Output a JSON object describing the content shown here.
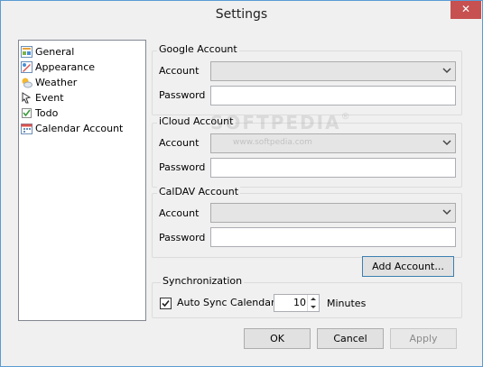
{
  "window": {
    "title": "Settings",
    "close_glyph": "✕"
  },
  "nav": {
    "items": [
      {
        "label": "General",
        "icon": "general-icon"
      },
      {
        "label": "Appearance",
        "icon": "appearance-icon"
      },
      {
        "label": "Weather",
        "icon": "weather-icon"
      },
      {
        "label": "Event",
        "icon": "event-icon"
      },
      {
        "label": "Todo",
        "icon": "todo-icon"
      },
      {
        "label": "Calendar Account",
        "icon": "calendar-account-icon"
      }
    ]
  },
  "google": {
    "title": "Google Account",
    "account_label": "Account",
    "account_value": "",
    "password_label": "Password",
    "password_value": ""
  },
  "icloud": {
    "title": "iCloud Account",
    "account_label": "Account",
    "account_value": "",
    "password_label": "Password",
    "password_value": ""
  },
  "caldav": {
    "title": "CalDAV Account",
    "account_label": "Account",
    "account_value": "",
    "password_label": "Password",
    "password_value": ""
  },
  "add_account_label": "Add Account...",
  "sync": {
    "title": "Synchronization",
    "auto_sync_label": "Auto Sync Calendar",
    "auto_sync_checked": true,
    "interval_value": "10",
    "interval_unit": "Minutes"
  },
  "footer": {
    "ok_label": "OK",
    "cancel_label": "Cancel",
    "apply_label": "Apply"
  },
  "watermark": {
    "brand": "SOFTPEDIA",
    "trademark": "®",
    "url": "www.softpedia.com"
  },
  "colors": {
    "border_accent": "#5b9bd5",
    "close_button": "#c75050",
    "window_bg": "#f0f0f0"
  }
}
